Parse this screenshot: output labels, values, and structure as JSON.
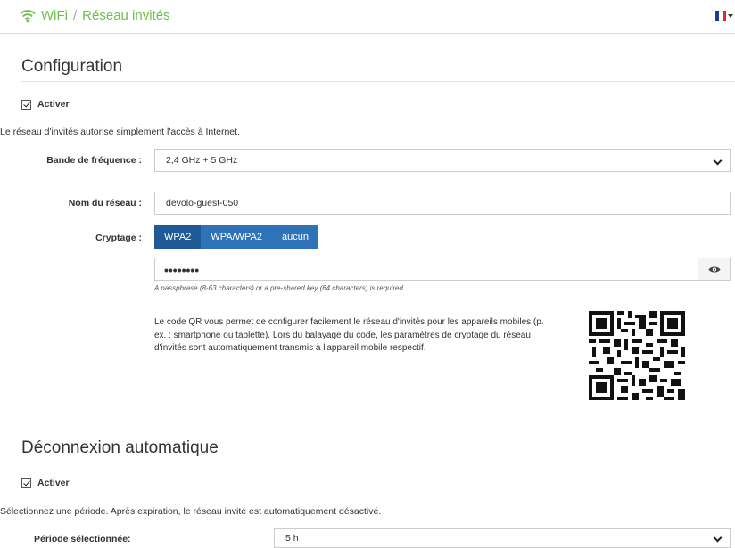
{
  "breadcrumb": {
    "section": "WiFi",
    "separator": "/",
    "page": "Réseau invités"
  },
  "icons": {
    "wifi": "wifi-icon",
    "flag": "french-flag-icon",
    "eye": "eye-icon",
    "qr": "qr-code"
  },
  "colors": {
    "accent_green": "#6cc04a",
    "segment_blue": "#2e73b8",
    "segment_active": "#1e5a95"
  },
  "config": {
    "title": "Configuration",
    "activate_label": "Activer",
    "activate_checked": true,
    "description": "Le réseau d'invités autorise simplement l'accès à Internet.",
    "band_label": "Bande de fréquence :",
    "band_value": "2,4 GHz + 5 GHz",
    "ssid_label": "Nom du réseau :",
    "ssid_value": "devolo-guest-050",
    "encryption_label": "Cryptage :",
    "encryption_options": [
      "WPA2",
      "WPA/WPA2",
      "aucun"
    ],
    "encryption_selected": "WPA2",
    "password_masked": "••••••••",
    "password_hint": "A passphrase (8-63 characters) or a pre-shared key (64 characters) is required",
    "qr_text": "Le code QR vous permet de configurer facilement le réseau d'invités pour les appareils mobiles (p. ex. : smartphone ou tablette). Lors du balayage du code, les paramètres de cryptage du réseau d'invités sont automatiquement transmis à l'appareil mobile respectif."
  },
  "auto_disconnect": {
    "title": "Déconnexion automatique",
    "activate_label": "Activer",
    "activate_checked": true,
    "description": "Sélectionnez une période. Après expiration, le réseau invité est automatiquement désactivé.",
    "period_label": "Période sélectionnée:",
    "period_value": "5 h"
  }
}
